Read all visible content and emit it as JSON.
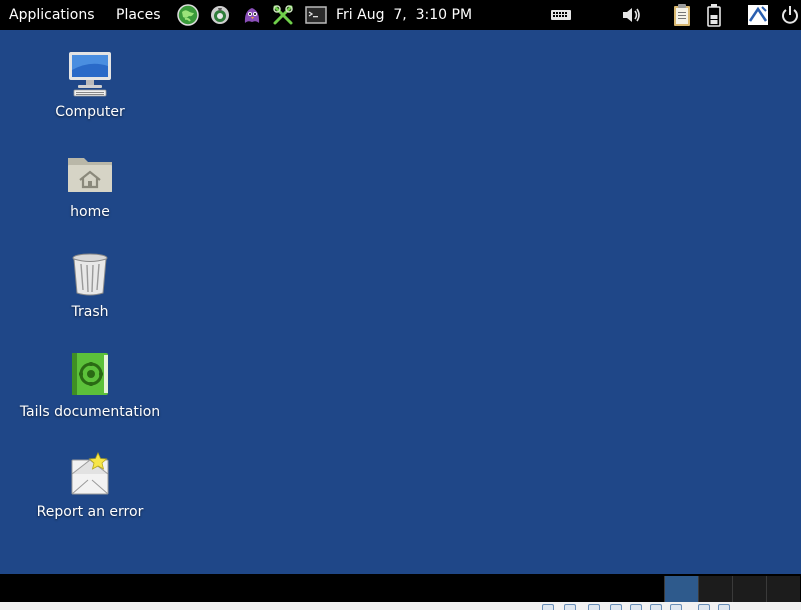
{
  "top_panel": {
    "applications_label": "Applications",
    "places_label": "Places",
    "clock": "Fri Aug  7,  3:10 PM",
    "launchers": [
      "tor-globe-icon",
      "tor-browser-icon",
      "pidgin-icon",
      "keyring-icon",
      "terminal-icon"
    ],
    "indicators": [
      "keyboard-icon",
      "volume-icon",
      "clipboard-icon",
      "battery-icon",
      "accessibility-icon",
      "power-icon"
    ]
  },
  "desktop": {
    "icons": [
      {
        "id": "computer",
        "label": "Computer",
        "icon": "computer-icon"
      },
      {
        "id": "home",
        "label": "home",
        "icon": "home-folder-icon"
      },
      {
        "id": "trash",
        "label": "Trash",
        "icon": "trash-icon"
      },
      {
        "id": "tails-documentation",
        "label": "Tails documentation",
        "icon": "book-icon"
      },
      {
        "id": "report-error",
        "label": "Report an error",
        "icon": "report-error-icon"
      }
    ]
  },
  "bottom_panel": {
    "workspaces": 4,
    "active_workspace": 1
  },
  "colors": {
    "desktop_background": "#1f4788",
    "panel_background": "#000000",
    "active_workspace": "#2e5a8c"
  }
}
